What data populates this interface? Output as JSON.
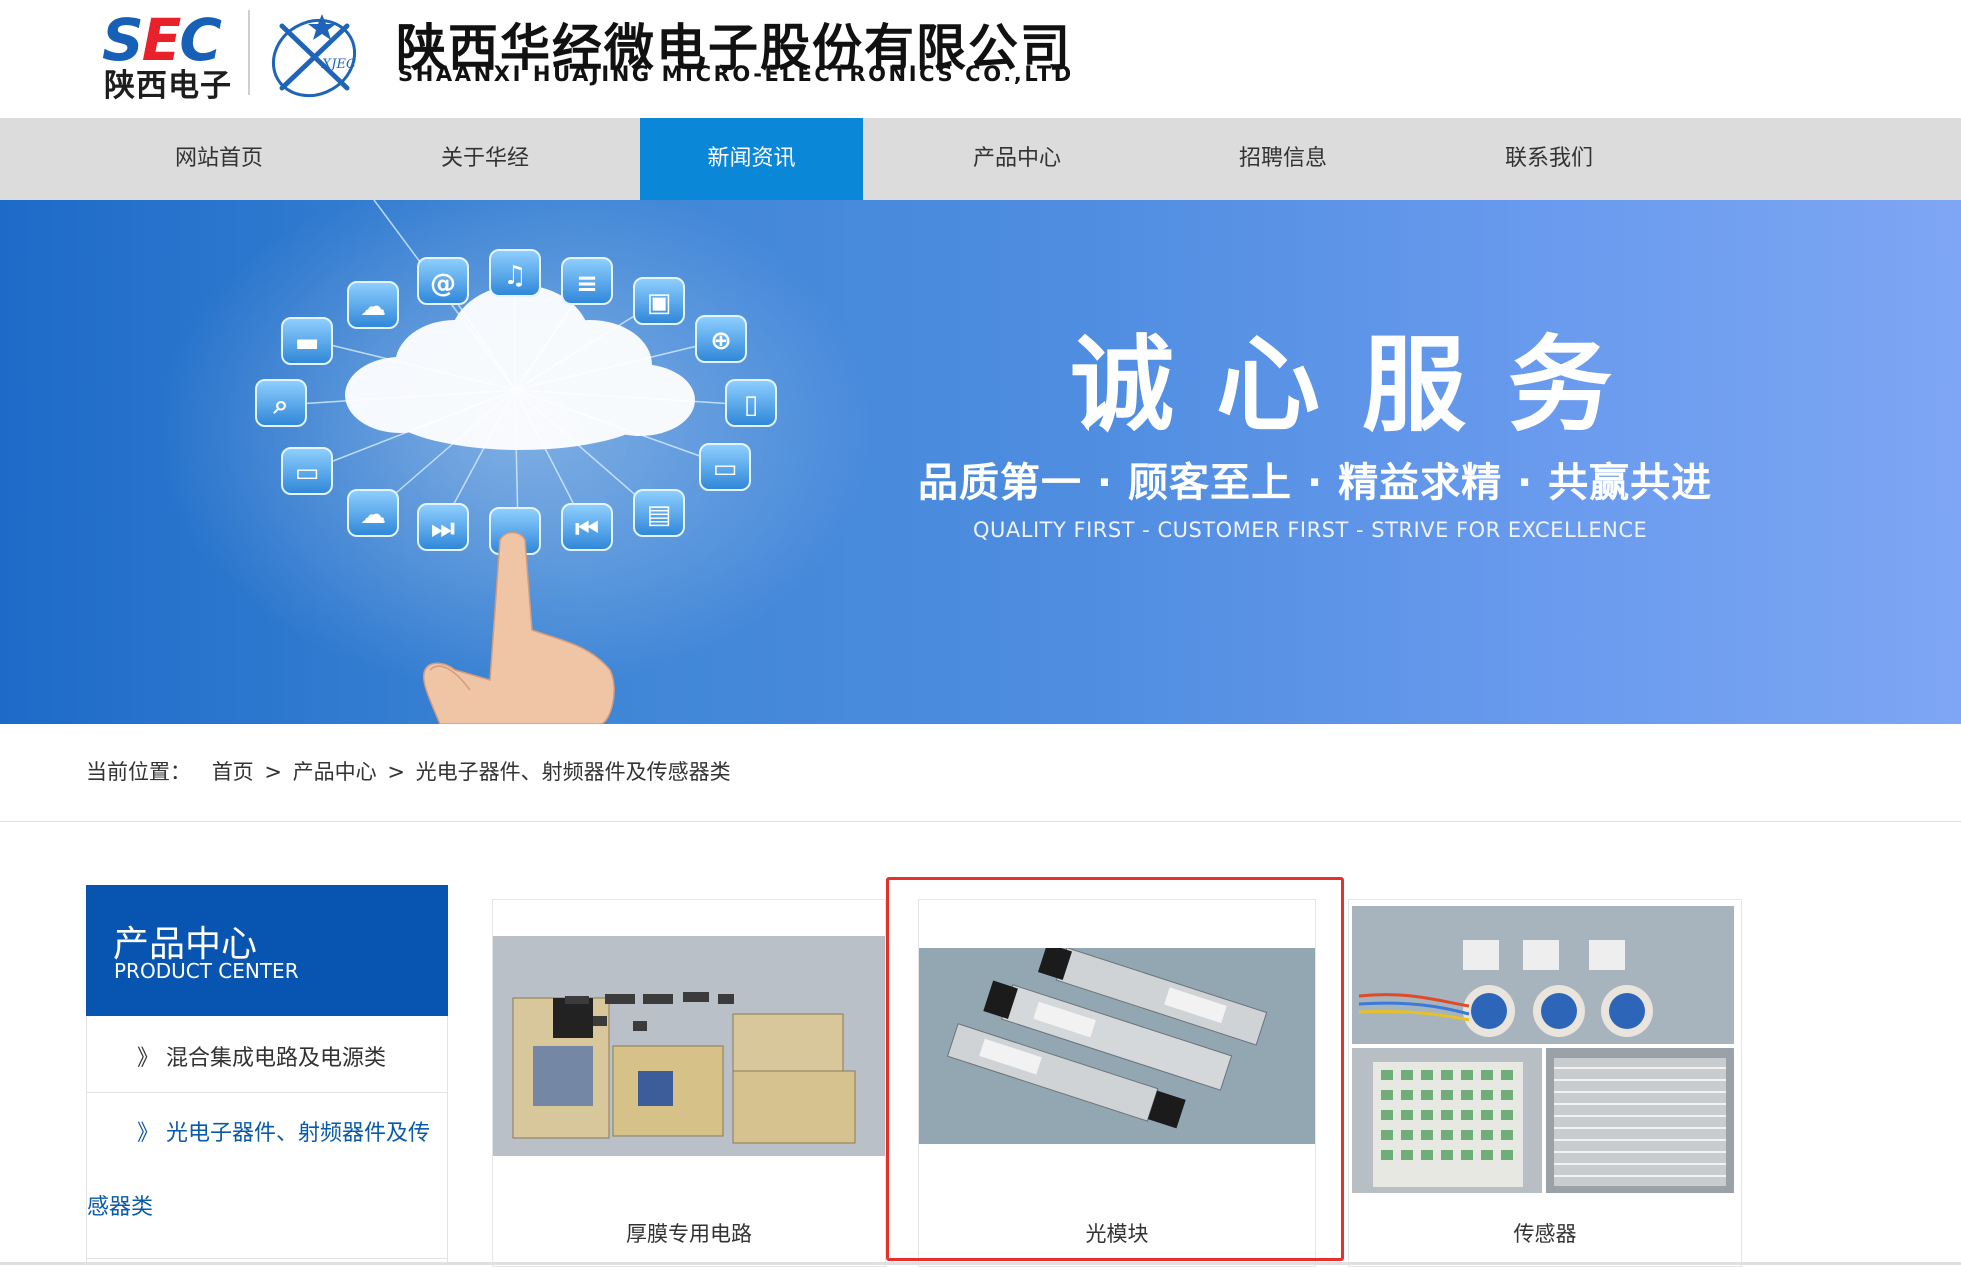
{
  "header": {
    "logo_sec_text": "SEC",
    "logo_sec_cn": "陕西电子",
    "logo_xjec_text": "XJEC",
    "company_cn": "陕西华经微电子股份有限公司",
    "company_en": "SHAANXI HUAJING MICRO-ELECTRONICS CO.,LTD"
  },
  "nav": {
    "items": [
      {
        "label": "网站首页"
      },
      {
        "label": "关于华经"
      },
      {
        "label": "新闻资讯",
        "active": true
      },
      {
        "label": "产品中心"
      },
      {
        "label": "招聘信息"
      },
      {
        "label": "联系我们"
      }
    ]
  },
  "banner": {
    "slogan_cn": "诚心服务",
    "slogan_sub": "品质第一 · 顾客至上 · 精益求精 · 共赢共进",
    "slogan_en": "QUALITY FIRST - CUSTOMER FIRST - STRIVE FOR EXCELLENCE"
  },
  "breadcrumb": {
    "label": "当前位置：",
    "home": "首页",
    "sep1": ">",
    "level1": "产品中心",
    "sep2": ">",
    "level2": "光电子器件、射频器件及传感器类"
  },
  "sidebar": {
    "title_cn": "产品中心",
    "title_en": "PRODUCT CENTER",
    "items": [
      {
        "label": "》 混合集成电路及电源类"
      },
      {
        "label_line1": "》 光电子器件、射频器件及传",
        "label_line2": "感器类",
        "active": true
      }
    ]
  },
  "products": [
    {
      "name": "厚膜专用电路",
      "icon": "thick-film-circuit-image"
    },
    {
      "name": "光模块",
      "icon": "optical-module-image",
      "highlighted": true
    },
    {
      "name": "传感器",
      "icon": "sensor-image"
    }
  ],
  "colors": {
    "brand_blue": "#0755b0",
    "nav_active": "#0a87d6",
    "highlight_red": "#e8302a"
  }
}
